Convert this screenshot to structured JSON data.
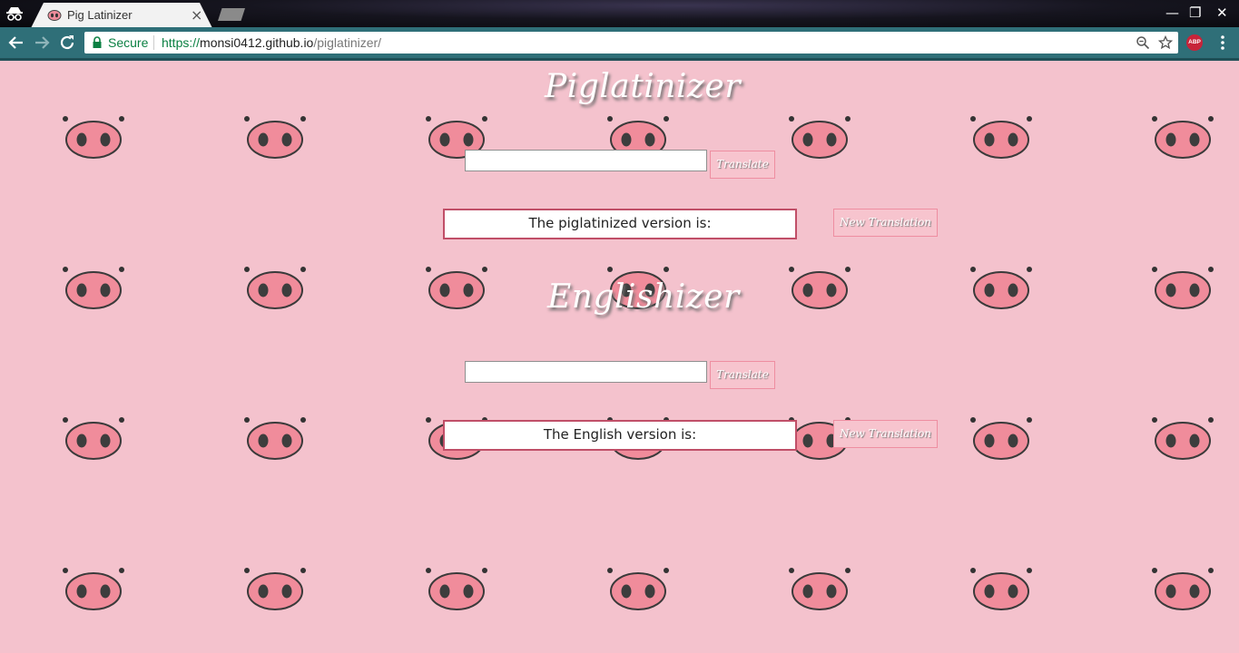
{
  "browser": {
    "tab_title": "Pig Latinizer",
    "tab_close": "×",
    "window_minimize": "—",
    "window_maximize": "❐",
    "window_close": "✕",
    "secure_label": "Secure",
    "url_scheme": "https://",
    "url_host": "monsi0412.github.io",
    "url_path": "/piglatinizer/",
    "extension_badge": "ABP"
  },
  "piglatinizer": {
    "title": "Piglatinizer",
    "input_value": "",
    "translate_label": "Translate",
    "result_label": "The piglatinized version is:",
    "new_translation_label": "New Translation"
  },
  "englishizer": {
    "title": "Englishizer",
    "input_value": "",
    "translate_label": "Translate",
    "result_label": "The English version is:",
    "new_translation_label": "New Translation"
  },
  "colors": {
    "page_background": "#f4c2cd",
    "snout": "#f08c9b",
    "result_border": "#c04f68",
    "toolbar": "#2f6f78"
  },
  "icons": [
    "incognito-icon",
    "pig-favicon-icon",
    "back-arrow-icon",
    "forward-arrow-icon",
    "reload-icon",
    "lock-icon",
    "zoom-icon",
    "star-icon",
    "adblock-icon",
    "menu-icon",
    "pig-snout-icon"
  ]
}
